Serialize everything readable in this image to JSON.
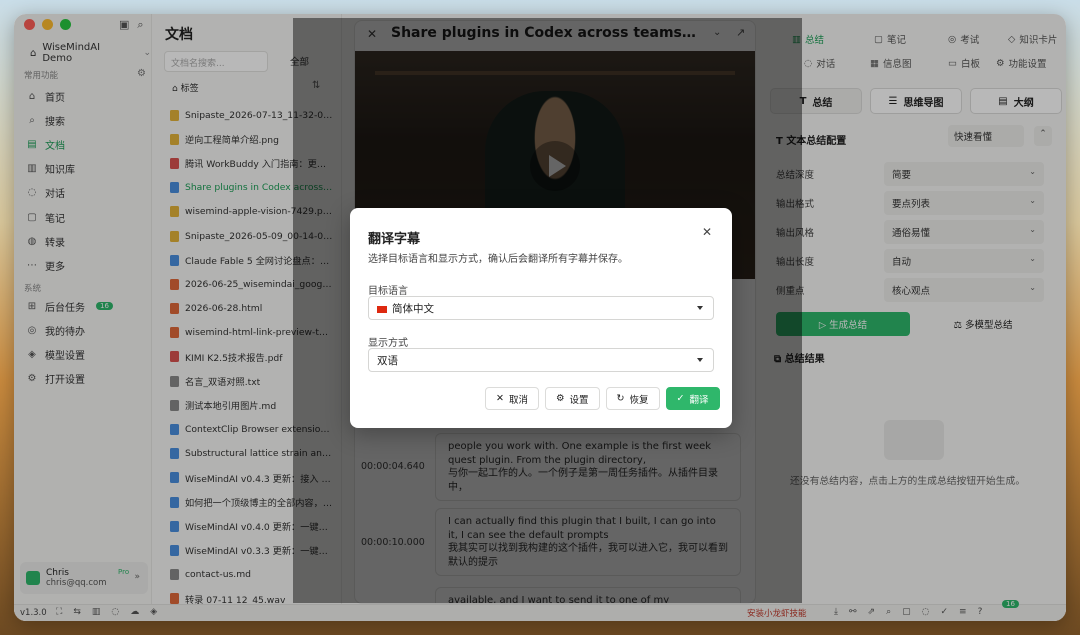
{
  "sidebar": {
    "workspace": "WiseMindAI Demo",
    "section_common": "常用功能",
    "section_system": "系统",
    "nav": [
      {
        "label": "首页",
        "icon": "home-icon"
      },
      {
        "label": "搜索",
        "icon": "search-icon"
      },
      {
        "label": "文档",
        "icon": "document-icon"
      },
      {
        "label": "知识库",
        "icon": "book-icon"
      },
      {
        "label": "对话",
        "icon": "chat-icon"
      },
      {
        "label": "笔记",
        "icon": "note-icon"
      },
      {
        "label": "转录",
        "icon": "transcribe-icon"
      },
      {
        "label": "更多",
        "icon": "more-icon"
      }
    ],
    "system_nav": [
      {
        "label": "后台任务",
        "icon": "tasks-icon",
        "badge": "16"
      },
      {
        "label": "我的待办",
        "icon": "todo-icon"
      },
      {
        "label": "模型设置",
        "icon": "model-icon"
      },
      {
        "label": "打开设置",
        "icon": "settings-icon"
      }
    ],
    "user": {
      "name": "Chris",
      "email": "chris@qq.com",
      "plan": "Pro"
    }
  },
  "doclist": {
    "title": "文档",
    "search_placeholder": "文档名搜索...",
    "filter": "全部",
    "tags_label": "标签",
    "files": [
      {
        "name": "Snipaste_2026-07-13_11-32-02.png",
        "type": "img"
      },
      {
        "name": "逆向工程简单介绍.png",
        "type": "img"
      },
      {
        "name": "腾讯 WorkBuddy 入门指南：更适合...",
        "type": "pdf"
      },
      {
        "name": "Share plugins in Codex across tea...",
        "type": "vid",
        "active": true
      },
      {
        "name": "wisemind-apple-vision-7429.png",
        "type": "img"
      },
      {
        "name": "Snipaste_2026-05-09_00-14-01...",
        "type": "img"
      },
      {
        "name": "Claude Fable 5 全网讨论盘点：从...",
        "type": "doc"
      },
      {
        "name": "2026-06-25_wisemindai_google_...",
        "type": "html"
      },
      {
        "name": "2026-06-28.html",
        "type": "html"
      },
      {
        "name": "wisemind-html-link-preview-test...",
        "type": "html"
      },
      {
        "name": "KIMI K2.5技术报告.pdf",
        "type": "pdf"
      },
      {
        "name": "名言_双语对照.txt",
        "type": "txt"
      },
      {
        "name": "测试本地引用图片.md",
        "type": "txt"
      },
      {
        "name": "ContextClip Browser extension (C...",
        "type": "doc"
      },
      {
        "name": "Substructural lattice strain and or...",
        "type": "doc"
      },
      {
        "name": "WiseMindAI v0.4.3 更新：接入 Oll...",
        "type": "doc"
      },
      {
        "name": "如何把一个顶级博主的全部内容，变...",
        "type": "doc"
      },
      {
        "name": "WiseMindAI v0.4.0 更新：一键转存...",
        "type": "doc"
      },
      {
        "name": "WiseMindAI v0.3.3 更新：一键保存...",
        "type": "doc"
      },
      {
        "name": "contact-us.md",
        "type": "txt"
      },
      {
        "name": "转录 07-11 12_45.wav",
        "type": "wav"
      }
    ]
  },
  "main": {
    "title": "Share plugins in Codex across teams.Team...",
    "segments": [
      {
        "time": "00:00:04.640",
        "text_en": "people you work with. One example is the first week quest plugin. From the plugin directory,",
        "text_zh": "与你一起工作的人。一个例子是第一周任务插件。从插件目录中，"
      },
      {
        "time": "00:00:10.000",
        "text_en": "I can actually find this plugin that I built, I can go into it, I can see the default prompts",
        "text_zh": "我其实可以找到我构建的这个插件，我可以进入它，我可以看到默认的提示"
      },
      {
        "time": "",
        "text_en": "available, and I want to send it to one of my teammates.",
        "text_zh": ""
      }
    ]
  },
  "right": {
    "tabs_row1": [
      {
        "label": "总结",
        "icon": "summary-icon",
        "active": true
      },
      {
        "label": "笔记",
        "icon": "note-icon"
      },
      {
        "label": "考试",
        "icon": "exam-icon"
      },
      {
        "label": "知识卡片",
        "icon": "card-icon"
      }
    ],
    "tabs_row2": [
      {
        "label": "对话",
        "icon": "chat-icon"
      },
      {
        "label": "信息图",
        "icon": "infographic-icon"
      },
      {
        "label": "白板",
        "icon": "whiteboard-icon"
      },
      {
        "label": "功能设置",
        "icon": "settings-icon"
      }
    ],
    "modes": [
      "总结",
      "思维导图",
      "大纲"
    ],
    "config_title": "文本总结配置",
    "config_mode": "快速看懂",
    "config": [
      {
        "label": "总结深度",
        "value": "简要"
      },
      {
        "label": "输出格式",
        "value": "要点列表"
      },
      {
        "label": "输出风格",
        "value": "通俗易懂"
      },
      {
        "label": "输出长度",
        "value": "自动"
      },
      {
        "label": "侧重点",
        "value": "核心观点"
      }
    ],
    "generate": "生成总结",
    "multi_model": "多模型总结",
    "result_title": "总结结果",
    "empty": "还没有总结内容，点击上方的生成总结按钮开始生成。"
  },
  "statusbar": {
    "version": "v1.3.0",
    "install": "安装小龙虾技能",
    "badge": "16"
  },
  "modal": {
    "title": "翻译字幕",
    "description": "选择目标语言和显示方式，确认后会翻译所有字幕并保存。",
    "target_label": "目标语言",
    "target_value": "简体中文",
    "display_label": "显示方式",
    "display_value": "双语",
    "cancel": "取消",
    "settings": "设置",
    "restore": "恢复",
    "translate": "翻译"
  },
  "colors": {
    "accent": "#2fb76b",
    "overlay": "rgba(0,0,0,0.45)"
  }
}
